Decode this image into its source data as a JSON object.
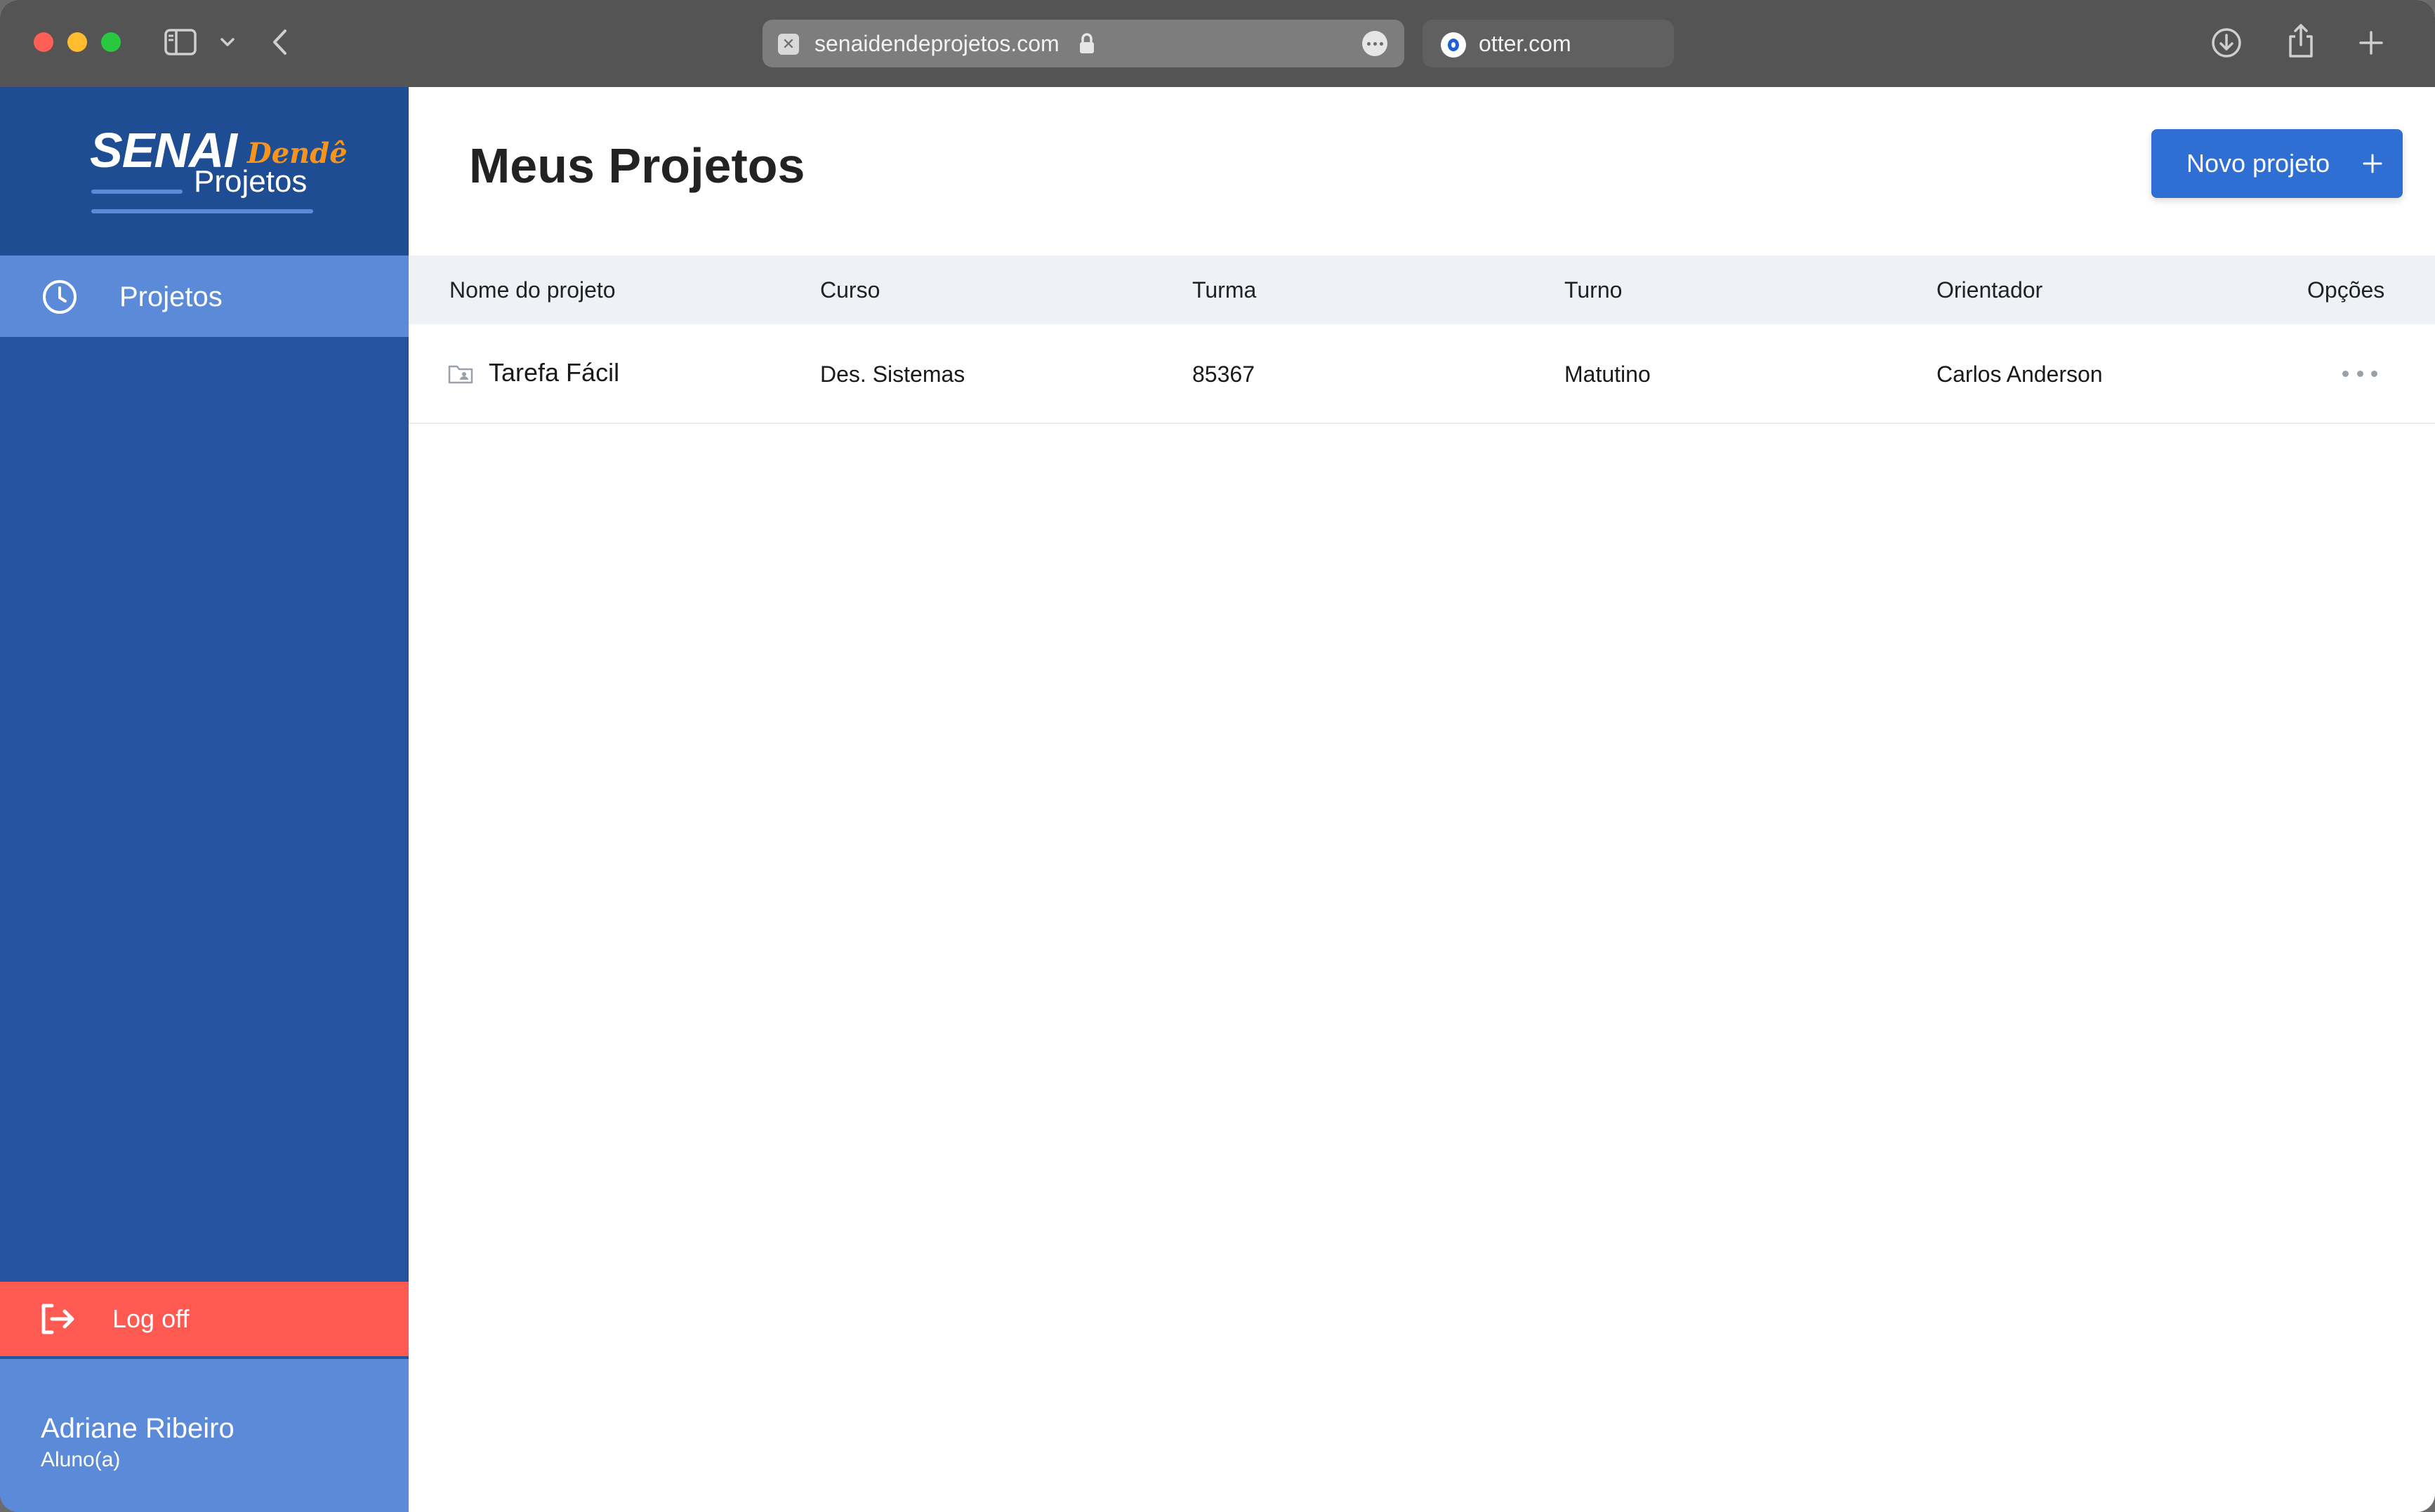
{
  "browser": {
    "active_tab_url": "senaidendeprojetos.com",
    "other_tab_label": "otter.com"
  },
  "sidebar": {
    "logo": {
      "senai": "SENAI",
      "dende": "Dendê",
      "projetos": "Projetos"
    },
    "nav_items": [
      {
        "label": "Projetos",
        "icon": "clock-icon",
        "active": true
      }
    ],
    "logoff_label": "Log off",
    "user": {
      "name": "Adriane Ribeiro",
      "role": "Aluno(a)"
    }
  },
  "main": {
    "title": "Meus Projetos",
    "new_project_label": "Novo projeto",
    "table": {
      "columns": [
        "Nome do projeto",
        "Curso",
        "Turma",
        "Turno",
        "Orientador",
        "Opções"
      ],
      "rows": [
        {
          "nome": "Tarefa Fácil",
          "curso": "Des. Sistemas",
          "turma": "85367",
          "turno": "Matutino",
          "orientador": "Carlos Anderson"
        }
      ]
    }
  },
  "colors": {
    "sidebar_bg": "#25549f",
    "sidebar_active": "#5b8ad9",
    "logoff_bg": "#ff5a52",
    "primary_button": "#2f6fd4",
    "logo_accent": "#f7941d",
    "table_header_bg": "#eef1f6"
  }
}
